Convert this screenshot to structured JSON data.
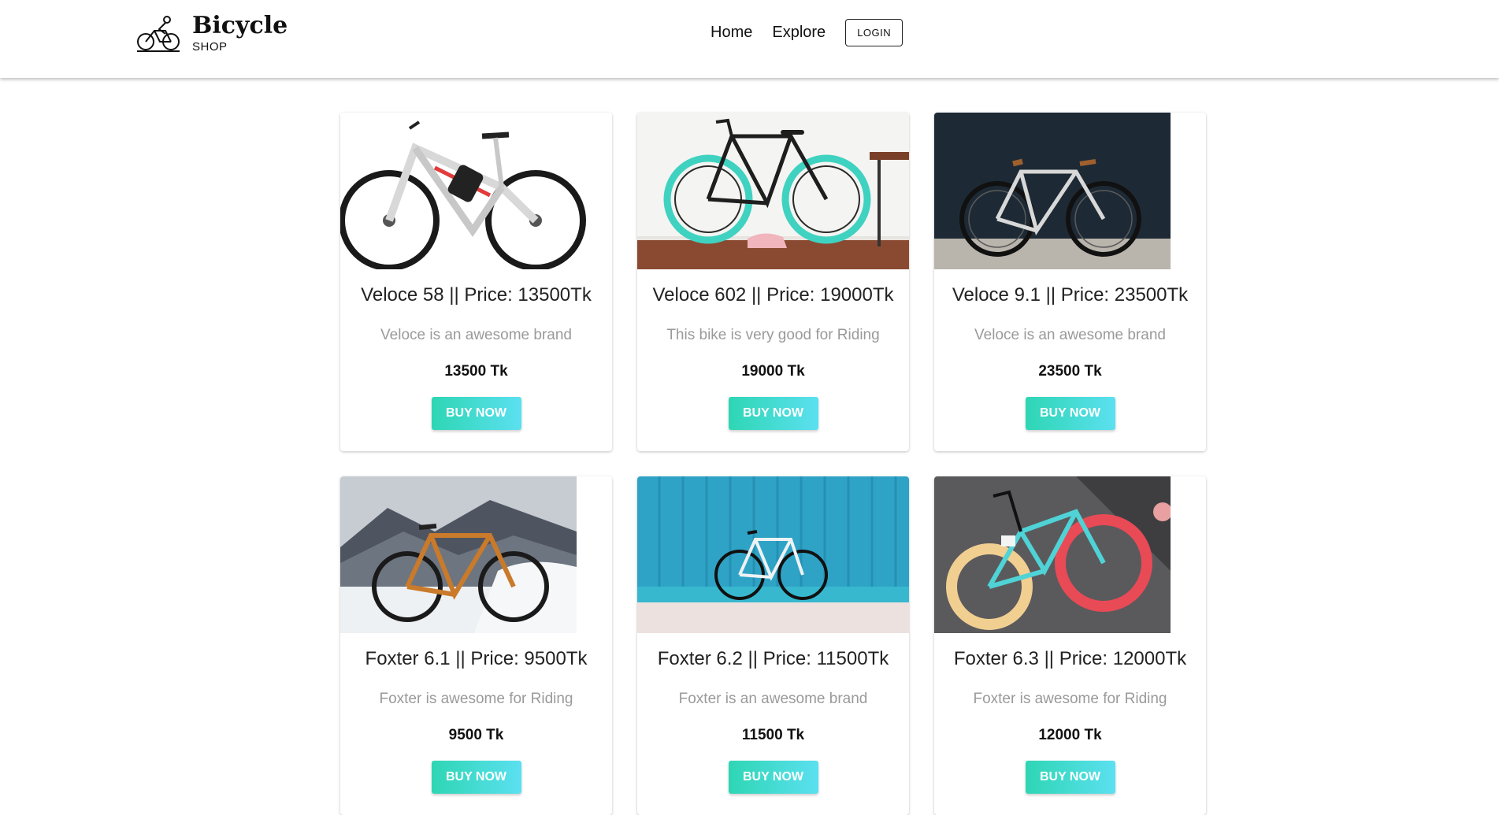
{
  "header": {
    "brand_name": "Bicycle",
    "brand_sub": "SHOP",
    "nav": [
      {
        "label": "Home"
      },
      {
        "label": "Explore"
      }
    ],
    "login_label": "LOGIN",
    "logo_icon": "cyclist-icon"
  },
  "products": [
    {
      "title": "Veloce 58 || Price: 13500Tk",
      "desc": "Veloce is an awesome brand",
      "price": "13500 Tk",
      "cta": "BUY NOW"
    },
    {
      "title": "Veloce 602 || Price: 19000Tk",
      "desc": "This bike is very good for Riding",
      "price": "19000 Tk",
      "cta": "BUY NOW"
    },
    {
      "title": "Veloce 9.1 || Price: 23500Tk",
      "desc": "Veloce is an awesome brand",
      "price": "23500 Tk",
      "cta": "BUY NOW"
    },
    {
      "title": "Foxter 6.1 || Price: 9500Tk",
      "desc": "Foxter is awesome for Riding",
      "price": "9500 Tk",
      "cta": "BUY NOW"
    },
    {
      "title": "Foxter 6.2 || Price: 11500Tk",
      "desc": "Foxter is an awesome brand",
      "price": "11500 Tk",
      "cta": "BUY NOW"
    },
    {
      "title": "Foxter 6.3 || Price: 12000Tk",
      "desc": "Foxter is awesome for Riding",
      "price": "12000 Tk",
      "cta": "BUY NOW"
    }
  ],
  "colors": {
    "button_gradient_start": "#2ed6b4",
    "button_gradient_end": "#5be0f0"
  }
}
